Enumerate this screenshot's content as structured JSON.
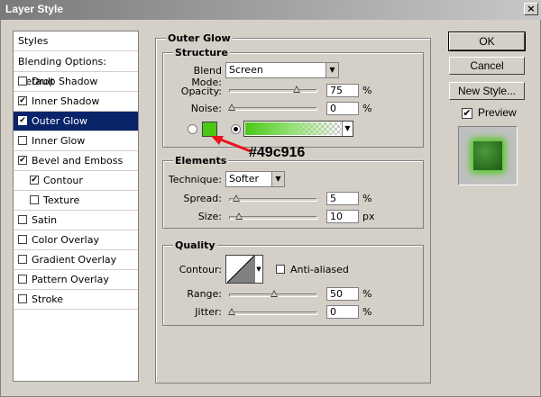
{
  "window": {
    "title": "Layer Style"
  },
  "styles": {
    "header": "Styles",
    "blending": "Blending Options: Default",
    "items": [
      {
        "label": "Drop Shadow",
        "checked": false
      },
      {
        "label": "Inner Shadow",
        "checked": true
      },
      {
        "label": "Outer Glow",
        "checked": true,
        "selected": true
      },
      {
        "label": "Inner Glow",
        "checked": false
      },
      {
        "label": "Bevel and Emboss",
        "checked": true
      },
      {
        "label": "Contour",
        "checked": true,
        "indent": true
      },
      {
        "label": "Texture",
        "checked": false,
        "indent": true
      },
      {
        "label": "Satin",
        "checked": false
      },
      {
        "label": "Color Overlay",
        "checked": false
      },
      {
        "label": "Gradient Overlay",
        "checked": false
      },
      {
        "label": "Pattern Overlay",
        "checked": false
      },
      {
        "label": "Stroke",
        "checked": false
      }
    ]
  },
  "outer_glow": {
    "title": "Outer Glow",
    "structure": {
      "title": "Structure",
      "blend_mode_label": "Blend Mode:",
      "blend_mode": "Screen",
      "opacity_label": "Opacity:",
      "opacity": "75",
      "opacity_unit": "%",
      "noise_label": "Noise:",
      "noise": "0",
      "noise_unit": "%",
      "glow_color": "#49c916"
    },
    "annotation": "#49c916",
    "elements": {
      "title": "Elements",
      "technique_label": "Technique:",
      "technique": "Softer",
      "spread_label": "Spread:",
      "spread": "5",
      "spread_unit": "%",
      "size_label": "Size:",
      "size": "10",
      "size_unit": "px"
    },
    "quality": {
      "title": "Quality",
      "contour_label": "Contour:",
      "anti_aliased_label": "Anti-aliased",
      "range_label": "Range:",
      "range": "50",
      "range_unit": "%",
      "jitter_label": "Jitter:",
      "jitter": "0",
      "jitter_unit": "%"
    }
  },
  "buttons": {
    "ok": "OK",
    "cancel": "Cancel",
    "new_style": "New Style...",
    "preview": "Preview"
  },
  "colors": {
    "selection": "#0a246a",
    "annotation_red": "#e8141b"
  }
}
